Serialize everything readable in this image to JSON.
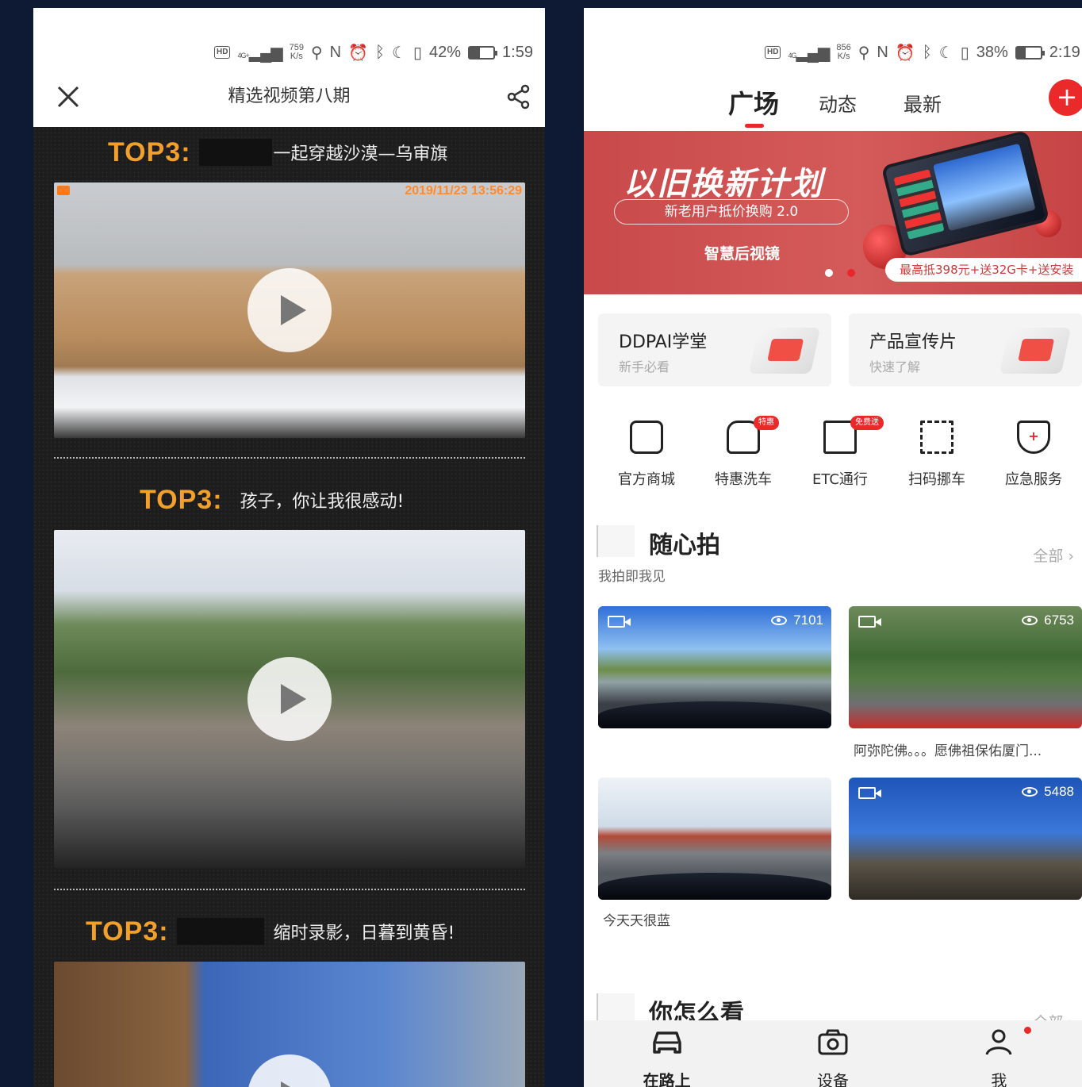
{
  "left_phone": {
    "status": {
      "net": "4G+",
      "speed_value": "759",
      "speed_unit": "K/s",
      "battery": "42%",
      "time": "1:59",
      "battery_level": 0.42
    },
    "header": {
      "title": "精选视频第八期"
    },
    "entries": [
      {
        "rank": "TOP3:",
        "caption": "一起穿越沙漠—乌审旗",
        "timestamp": "2019/11/23 13:56:29"
      },
      {
        "rank": "TOP3:",
        "caption": "孩子，你让我很感动!"
      },
      {
        "rank": "TOP3:",
        "caption": "缩时录影，日暮到黄昏!"
      }
    ]
  },
  "right_phone": {
    "status": {
      "net": "4G",
      "speed_value": "856",
      "speed_unit": "K/s",
      "battery": "38%",
      "time": "2:19",
      "battery_level": 0.38
    },
    "tabs": [
      {
        "label": "广场",
        "active": true
      },
      {
        "label": "动态"
      },
      {
        "label": "最新"
      }
    ],
    "add_icon": "plus-icon",
    "banner": {
      "headline": "以旧换新计划",
      "pill": "新老用户抵价换购 2.0",
      "subtitle": "智慧后视镜",
      "promo": "最高抵398元+送32G卡+送安装",
      "active_slide": 2
    },
    "cards": [
      {
        "title": "DDPAI学堂",
        "subtitle": "新手必看"
      },
      {
        "title": "产品宣传片",
        "subtitle": "快速了解"
      }
    ],
    "services": [
      {
        "label": "官方商城",
        "icon": "store-icon"
      },
      {
        "label": "特惠洗车",
        "icon": "car-wash-icon",
        "badge": "特惠"
      },
      {
        "label": "ETC通行",
        "icon": "etc-icon",
        "badge": "免费送"
      },
      {
        "label": "扫码挪车",
        "icon": "qr-code-icon"
      },
      {
        "label": "应急服务",
        "icon": "shield-plus-icon"
      }
    ],
    "section1": {
      "title": "随心拍",
      "subtitle": "我拍即我见",
      "more": "全部 ›"
    },
    "videos": [
      {
        "views": "7101",
        "caption": ""
      },
      {
        "views": "6753",
        "caption": "阿弥陀佛。。。愿佛祖保佑厦门..."
      },
      {
        "views": "",
        "caption": "今天天很蓝"
      },
      {
        "views": "5488",
        "caption": ""
      }
    ],
    "section2": {
      "title": "你怎么看",
      "more": "全部 ›"
    },
    "bottom_nav": [
      {
        "label": "在路上",
        "icon": "car-front-icon",
        "active": true
      },
      {
        "label": "设备",
        "icon": "camera-icon"
      },
      {
        "label": "我",
        "icon": "person-icon"
      }
    ]
  },
  "colors": {
    "accent": "#e8262e",
    "top_label": "#f3a02a",
    "background": "#0e1a33"
  }
}
